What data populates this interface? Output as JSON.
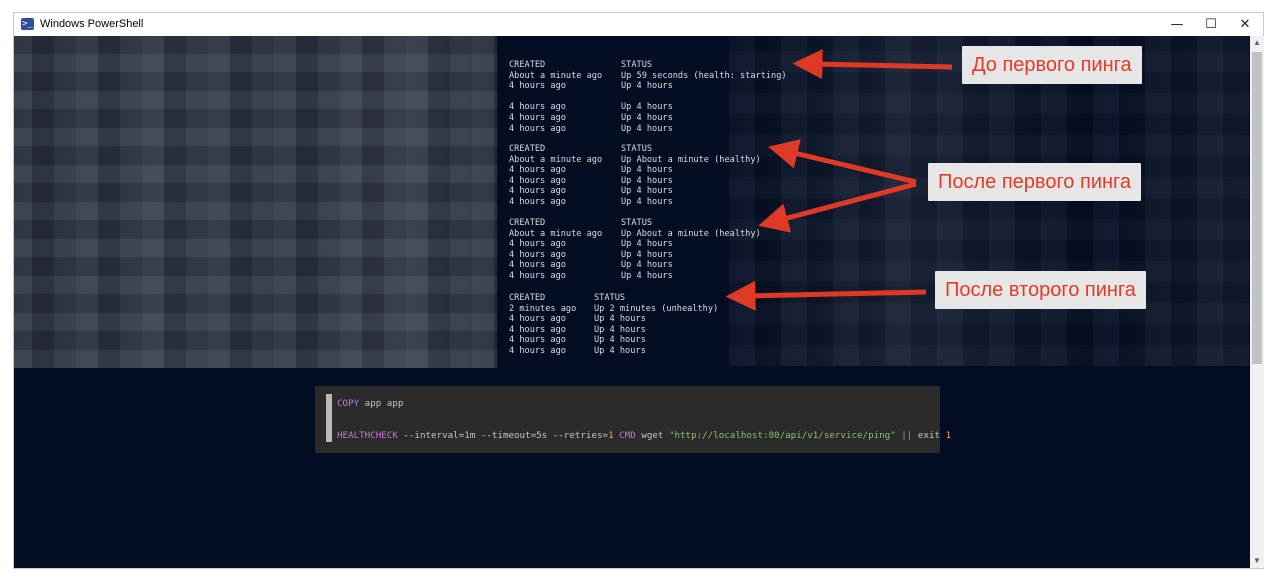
{
  "window": {
    "title": "Windows PowerShell",
    "minimize": "—",
    "maximize": "☐",
    "close": "✕"
  },
  "terminal": {
    "blocks": [
      {
        "headers": [
          "CREATED",
          "STATUS"
        ],
        "rows": [
          [
            "About a minute ago",
            "Up 59 seconds (health: starting)"
          ],
          [
            "4 hours ago",
            "Up 4 hours"
          ],
          [
            "",
            ""
          ],
          [
            "4 hours ago",
            "Up 4 hours"
          ],
          [
            "4 hours ago",
            "Up 4 hours"
          ],
          [
            "4 hours ago",
            "Up 4 hours"
          ]
        ]
      },
      {
        "headers": [
          "CREATED",
          "STATUS"
        ],
        "rows": [
          [
            "About a minute ago",
            "Up About a minute (healthy)"
          ],
          [
            "4 hours ago",
            "Up 4 hours"
          ],
          [
            "4 hours ago",
            "Up 4 hours"
          ],
          [
            "4 hours ago",
            "Up 4 hours"
          ],
          [
            "4 hours ago",
            "Up 4 hours"
          ]
        ]
      },
      {
        "headers": [
          "CREATED",
          "STATUS"
        ],
        "rows": [
          [
            "About a minute ago",
            "Up About a minute (healthy)"
          ],
          [
            "4 hours ago",
            "Up 4 hours"
          ],
          [
            "4 hours ago",
            "Up 4 hours"
          ],
          [
            "4 hours ago",
            "Up 4 hours"
          ],
          [
            "4 hours ago",
            "Up 4 hours"
          ]
        ]
      },
      {
        "headers": [
          "CREATED",
          "STATUS"
        ],
        "rows": [
          [
            "2 minutes ago",
            "Up 2 minutes (unhealthy)"
          ],
          [
            "4 hours ago",
            "Up 4 hours"
          ],
          [
            "4 hours ago",
            "Up 4 hours"
          ],
          [
            "4 hours ago",
            "Up 4 hours"
          ],
          [
            "4 hours ago",
            "Up 4 hours"
          ]
        ]
      }
    ]
  },
  "callouts": {
    "before_first_ping": "До первого пинга",
    "after_first_ping": "После первого пинга",
    "after_second_ping": "После второго пинга"
  },
  "code": {
    "line1": {
      "keyword": "COPY",
      "args": " app app"
    },
    "line2": {
      "keyword": "HEALTHCHECK",
      "opts": " --interval=1m --timeout=5s --retries=",
      "retries": "1",
      "cmd": " CMD",
      "wget": " wget ",
      "url": "\"http://localhost:80/api/v1/service/ping\"",
      "or": " ||",
      "exit": " exit ",
      "code": "1"
    }
  },
  "colors": {
    "console_bg": "#030d22",
    "callout_text": "#e63a26",
    "arrow": "#e03a26"
  }
}
